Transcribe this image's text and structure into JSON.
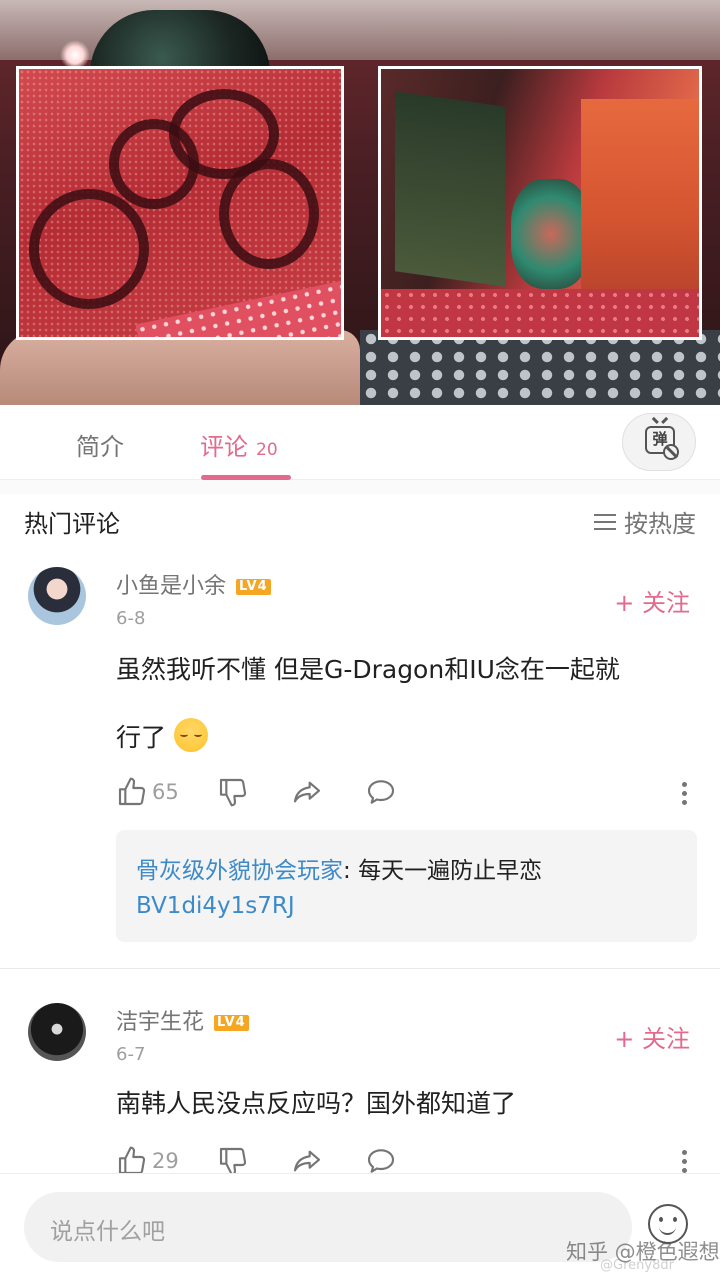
{
  "tabs": {
    "intro_label": "简介",
    "comments_label": "评论",
    "comments_count": "20"
  },
  "danmaku_toggle": {
    "glyph": "弹"
  },
  "hot_comments": {
    "title": "热门评论",
    "sort_label": "按热度"
  },
  "comments": [
    {
      "username": "小鱼是小余",
      "level": "LV4",
      "date": "6-8",
      "follow_label": "+ 关注",
      "text_line1": "虽然我听不懂 但是G-Dragon和IU念在一起就",
      "text_line2": "行了",
      "likes": "65",
      "reply": {
        "user": "骨灰级外貌协会玩家",
        "separator": ": ",
        "text": "每天一遍防止早恋",
        "link": "BV1di4y1s7RJ"
      }
    },
    {
      "username": "洁宇生花",
      "level": "LV4",
      "date": "6-7",
      "follow_label": "+ 关注",
      "text_line1": "南韩人民没点反应吗？国外都知道了",
      "likes": "29"
    }
  ],
  "input": {
    "placeholder": "说点什么吧"
  },
  "watermark": {
    "main": "知乎 @橙色遐想",
    "sub": "@Greny8dr"
  },
  "colors": {
    "accent": "#e36a8d",
    "link": "#3d8ac9",
    "level_badge": "#f5a623"
  },
  "icons": [
    "thumbs-up-icon",
    "thumbs-down-icon",
    "share-icon",
    "reply-bubble-icon",
    "more-vertical-icon",
    "danmaku-off-icon",
    "emoji-icon",
    "sort-menu-icon"
  ]
}
